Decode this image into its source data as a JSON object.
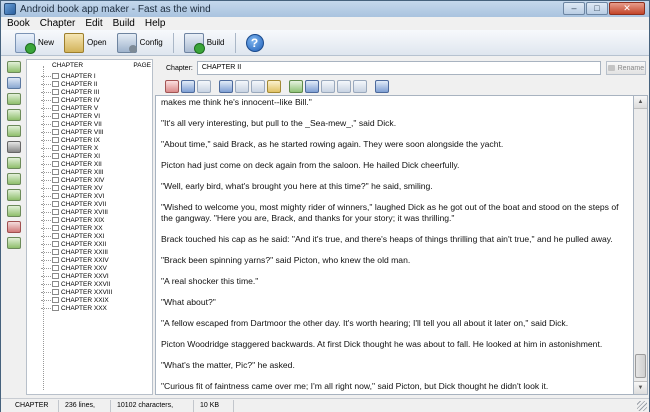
{
  "window": {
    "title": "Android book app maker - Fast as the wind"
  },
  "menu": [
    "Book",
    "Chapter",
    "Edit",
    "Build",
    "Help"
  ],
  "toolbar": {
    "new_label": "New",
    "open_label": "Open",
    "config_label": "Config",
    "build_label": "Build"
  },
  "tree": {
    "root": "",
    "col_chapter": "CHAPTER",
    "col_page": "PAGE",
    "items": [
      "CHAPTER I",
      "CHAPTER II",
      "CHAPTER III",
      "CHAPTER IV",
      "CHAPTER V",
      "CHAPTER VI",
      "CHAPTER VII",
      "CHAPTER VIII",
      "CHAPTER IX",
      "CHAPTER X",
      "CHAPTER XI",
      "CHAPTER XII",
      "CHAPTER XIII",
      "CHAPTER XIV",
      "CHAPTER XV",
      "CHAPTER XVI",
      "CHAPTER XVII",
      "CHAPTER XVIII",
      "CHAPTER XIX",
      "CHAPTER XX",
      "CHAPTER XXI",
      "CHAPTER XXII",
      "CHAPTER XXIII",
      "CHAPTER XXIV",
      "CHAPTER XXV",
      "CHAPTER XXVI",
      "CHAPTER XXVII",
      "CHAPTER XXVIII",
      "CHAPTER XXIX",
      "CHAPTER XXX"
    ]
  },
  "chapter_bar": {
    "label": "Chapter:",
    "value": "CHAPTER II",
    "rename_label": "Rename"
  },
  "text": {
    "paragraphs": [
      "makes me think he's innocent--like Bill.\"",
      "\"It's all very interesting, but pull to the _Sea-mew_,\" said Dick.",
      "\"About time,\" said Brack, as he started rowing again. They were soon alongside the yacht.",
      "Picton had just come on deck again from the saloon. He hailed Dick cheerfully.",
      "\"Well, early bird, what's brought you here at this time?\" he said, smiling.",
      "\"Wished to welcome you, most mighty rider of winners,\" laughed Dick as he got out of the boat and stood on the steps of the gangway. \"Here you are, Brack, and thanks for your story; it was thrilling.\"",
      "Brack touched his cap as he said: \"And it's true, and there's heaps of things thrilling that ain't true,\" and he pulled away.",
      "\"Brack been spinning yarns?\" said Picton, who knew the old man.",
      "\"A real shocker this time.\"",
      "\"What about?\"",
      "\"A fellow escaped from Dartmoor the other day. It's worth hearing; I'll tell you all about it later on,\" said Dick.",
      "Picton Woodridge staggered backwards. At first Dick thought he was about to fall. He looked at him in astonishment.",
      "\"What's the matter, Pic?\" he asked.",
      "\"Curious fit of faintness came over me; I'm all right now,\" said Picton, but Dick thought he didn't look it."
    ]
  },
  "status": {
    "chapter": "CHAPTER II",
    "lines": "236 lines,",
    "characters": "10102 characters,",
    "size": "10 KB"
  }
}
